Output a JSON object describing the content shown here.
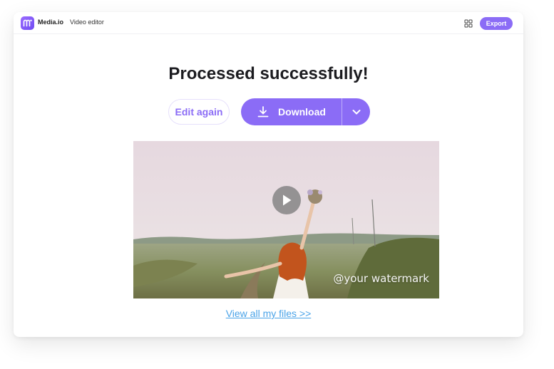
{
  "app": {
    "brand": "Media.io",
    "product": "Video editor",
    "logo_icon": "mediaio-logo-icon",
    "accent_color": "#8b6cf6"
  },
  "toolbar": {
    "apps_icon": "grid-icon",
    "export_label": "Export"
  },
  "main": {
    "headline": "Processed successfully!",
    "edit_again_label": "Edit again",
    "download_label": "Download",
    "download_icon": "download-icon",
    "download_menu_icon": "chevron-down-icon",
    "preview": {
      "play_icon": "play-icon",
      "watermark": "@your watermark"
    },
    "view_files_label": "View all my files >>"
  }
}
